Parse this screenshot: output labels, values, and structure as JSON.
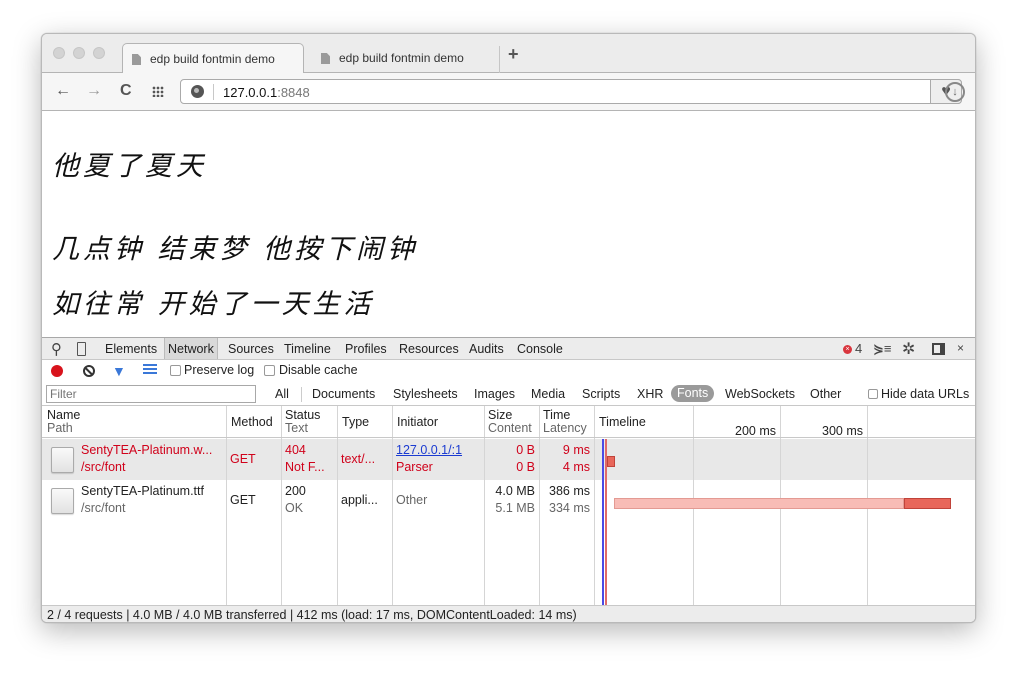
{
  "browser": {
    "tabs": [
      {
        "label": "edp build fontmin demo",
        "active": true,
        "icon": "document-icon"
      },
      {
        "label": "edp build fontmin demo",
        "active": false,
        "icon": "document-icon"
      }
    ],
    "new_tab_label": "+",
    "nav": {
      "back": "←",
      "forward": "→",
      "reload": "C"
    },
    "url_host": "127.0.0.1",
    "url_port": ":8848",
    "bookmark_icon": "♥",
    "download_icon": "↓"
  },
  "page": {
    "lines": [
      "他夏了夏天",
      "几点钟 结束梦 他按下闹钟",
      "如往常 开始了一天生活"
    ]
  },
  "devtools": {
    "panels": [
      "Elements",
      "Network",
      "Sources",
      "Timeline",
      "Profiles",
      "Resources",
      "Audits",
      "Console"
    ],
    "active_panel": "Network",
    "error_count": "4",
    "controls": {
      "preserve_log": "Preserve log",
      "disable_cache": "Disable cache"
    },
    "filter_placeholder": "Filter",
    "types": [
      "All",
      "Documents",
      "Stylesheets",
      "Images",
      "Media",
      "Scripts",
      "XHR",
      "Fonts",
      "WebSockets",
      "Other"
    ],
    "selected_type": "Fonts",
    "hide_data_urls": "Hide data URLs",
    "columns": {
      "name": "Name",
      "path": "Path",
      "method": "Method",
      "status": "Status",
      "status_text": "Text",
      "type": "Type",
      "initiator": "Initiator",
      "size": "Size",
      "content": "Content",
      "time": "Time",
      "latency": "Latency",
      "timeline": "Timeline",
      "tick1": "200 ms",
      "tick2": "300 ms"
    },
    "requests": [
      {
        "name": "SentyTEA-Platinum.w...",
        "path": "/src/font",
        "method": "GET",
        "status": "404",
        "status_text": "Not F...",
        "type": "text/...",
        "initiator": "127.0.0.1/:1",
        "initiator_type": "Parser",
        "size": "0 B",
        "content": "0 B",
        "time": "9 ms",
        "latency": "4 ms",
        "error": true
      },
      {
        "name": "SentyTEA-Platinum.ttf",
        "path": "/src/font",
        "method": "GET",
        "status": "200",
        "status_text": "OK",
        "type": "appli...",
        "initiator": "Other",
        "initiator_type": "",
        "size": "4.0 MB",
        "content": "5.1 MB",
        "time": "386 ms",
        "latency": "334 ms",
        "error": false
      }
    ],
    "status_bar": "2 / 4 requests | 4.0 MB / 4.0 MB transferred | 412 ms (load: 17 ms, DOMContentLoaded: 14 ms)"
  }
}
